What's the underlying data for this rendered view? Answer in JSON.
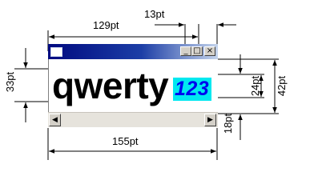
{
  "labels": {
    "client_width": "129pt",
    "highlight_width": "13pt",
    "window_width": "155pt",
    "text_height": "33pt",
    "highlight_height": "24pt",
    "window_height": "42pt",
    "scrollbar_height": "18pt"
  },
  "window": {
    "main_text": "qwerty",
    "highlight_text": "123",
    "minimize_glyph": "_",
    "maximize_glyph": "□",
    "close_glyph": "×",
    "scroll_left_glyph": "◀",
    "scroll_right_glyph": "▶"
  },
  "colors": {
    "titlebar_start": "#000a80",
    "titlebar_end": "#c4d4ec",
    "highlight_bg": "#00e8f0",
    "highlight_text": "#0000ee"
  }
}
